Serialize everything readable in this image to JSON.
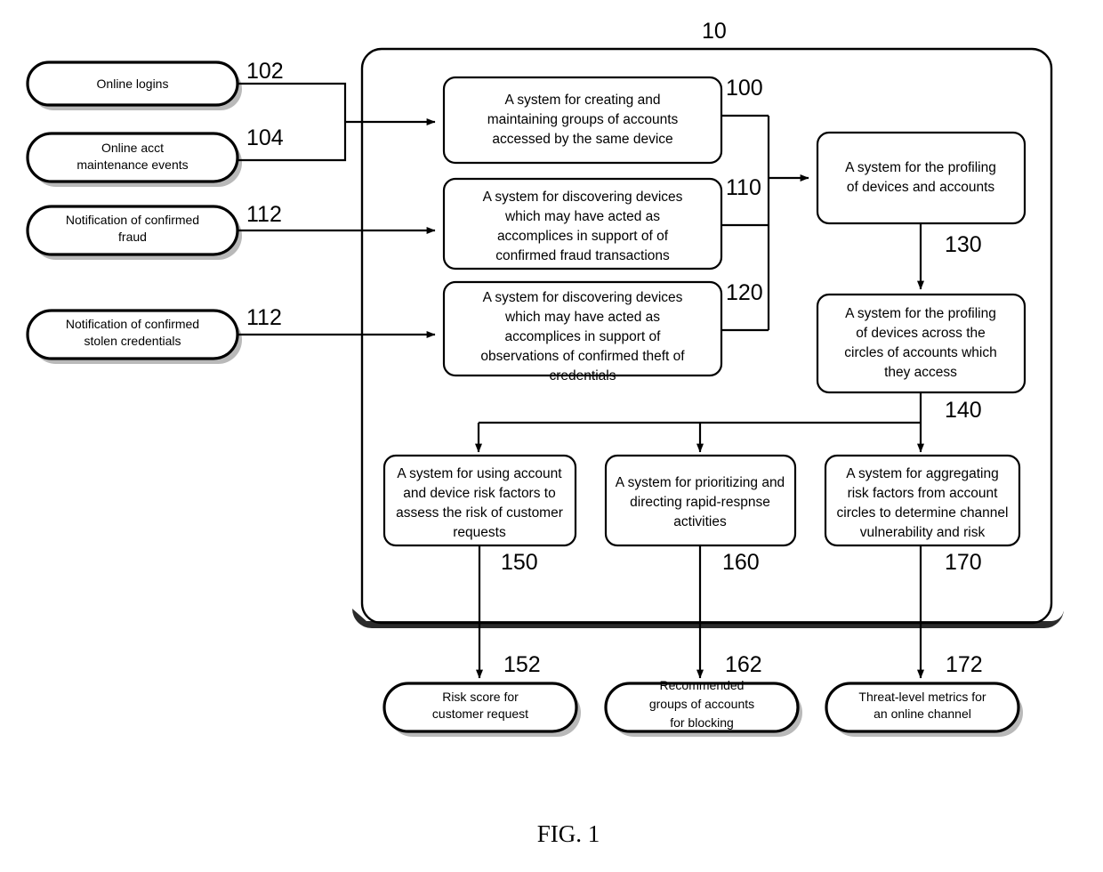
{
  "figure": {
    "caption": "FIG. 1",
    "system_label": "10"
  },
  "inputs": [
    {
      "id": "102",
      "label_lines": [
        "Online logins"
      ]
    },
    {
      "id": "104",
      "label_lines": [
        "Online acct",
        "maintenance events"
      ]
    },
    {
      "id": "112",
      "label_lines": [
        "Notification of confirmed",
        "fraud"
      ]
    },
    {
      "id": "112b",
      "ref": "112",
      "label_lines": [
        "Notification of confirmed",
        "stolen credentials"
      ]
    }
  ],
  "processes": [
    {
      "id": "100",
      "label_lines": [
        "A system for creating and",
        "maintaining groups of accounts",
        "accessed by the same device"
      ]
    },
    {
      "id": "110",
      "label_lines": [
        "A system for discovering devices",
        "which may have acted as",
        "accomplices in support of of",
        "confirmed fraud transactions"
      ]
    },
    {
      "id": "120",
      "label_lines": [
        "A system for discovering devices",
        "which may have acted as",
        "accomplices in support of",
        "observations of confirmed theft of",
        "credentials"
      ]
    },
    {
      "id": "130",
      "label_lines": [
        "A system for the profiling",
        "of devices and accounts"
      ]
    },
    {
      "id": "140",
      "label_lines": [
        "A system for the profiling",
        "of devices across the",
        "circles of accounts which",
        "they access"
      ]
    },
    {
      "id": "150",
      "label_lines": [
        "A system for using account",
        "and device risk factors to",
        "assess the risk of customer",
        "requests"
      ]
    },
    {
      "id": "160",
      "label_lines": [
        "A system for prioritizing and",
        "directing rapid-respnse",
        "activities"
      ]
    },
    {
      "id": "170",
      "label_lines": [
        "A system for aggregating",
        "risk factors from account",
        "circles to determine channel",
        "vulnerability and risk"
      ]
    }
  ],
  "outputs": [
    {
      "id": "152",
      "label_lines": [
        "Risk score for",
        "customer request"
      ]
    },
    {
      "id": "162",
      "label_lines": [
        "Recommended",
        "groups of accounts",
        "for blocking"
      ]
    },
    {
      "id": "172",
      "label_lines": [
        "Threat-level metrics for",
        "an online channel"
      ]
    }
  ],
  "colors": {
    "stroke": "#000000",
    "fill": "#ffffff",
    "shadow": "#b9b9b9"
  }
}
